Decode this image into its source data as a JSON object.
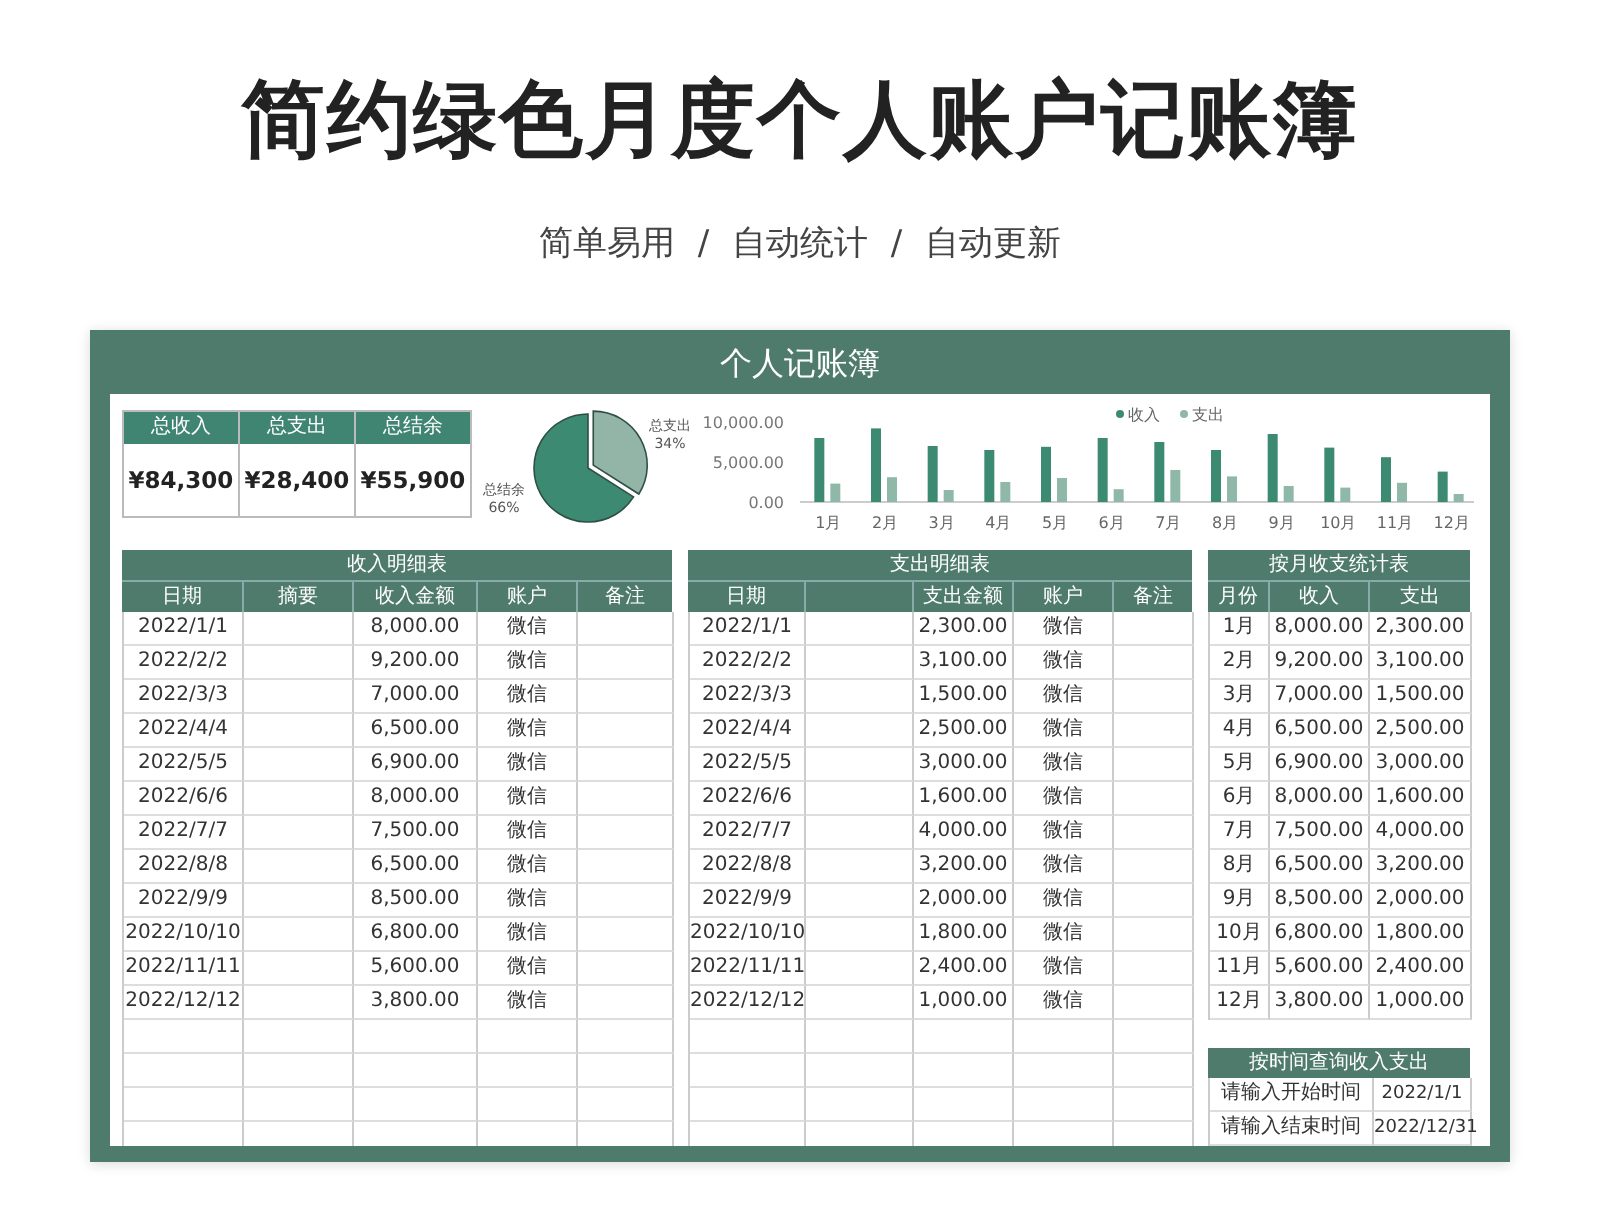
{
  "title": "简约绿色月度个人账户记账簿",
  "subtitle": "简单易用 / 自动统计 / 自动更新",
  "sheet": {
    "title": "个人记账簿",
    "summary": [
      {
        "label": "总收入",
        "value": "¥84,300"
      },
      {
        "label": "总支出",
        "value": "¥28,400"
      },
      {
        "label": "总结余",
        "value": "¥55,900"
      }
    ],
    "pie": {
      "chart_data": {
        "type": "pie",
        "categories": [
          "总支出",
          "总结余"
        ],
        "values": [
          34,
          66
        ],
        "value_labels": [
          "34%",
          "66%"
        ]
      }
    },
    "bars": {
      "chart_data": {
        "type": "bar",
        "categories": [
          "1月",
          "2月",
          "3月",
          "4月",
          "5月",
          "6月",
          "7月",
          "8月",
          "9月",
          "10月",
          "11月",
          "12月"
        ],
        "series": [
          {
            "name": "收入",
            "color": "#3d8a72",
            "values": [
              8000,
              9200,
              7000,
              6500,
              6900,
              8000,
              7500,
              6500,
              8500,
              6800,
              5600,
              3800
            ]
          },
          {
            "name": "支出",
            "color": "#8fb8a8",
            "values": [
              2300,
              3100,
              1500,
              2500,
              3000,
              1600,
              4000,
              3200,
              2000,
              1800,
              2400,
              1000
            ]
          }
        ],
        "legend": "top",
        "ylim": [
          0,
          10000
        ],
        "yticks": [
          {
            "value": 0,
            "label": "0.00"
          },
          {
            "value": 5000,
            "label": "5,000.00"
          },
          {
            "value": 10000,
            "label": "10,000.00"
          }
        ]
      }
    },
    "income": {
      "title": "收入明细表",
      "columns": [
        "日期",
        "摘要",
        "收入金额",
        "账户",
        "备注"
      ],
      "rows": [
        {
          "date": "2022/1/1",
          "amount": "8,000.00",
          "account": "微信"
        },
        {
          "date": "2022/2/2",
          "amount": "9,200.00",
          "account": "微信"
        },
        {
          "date": "2022/3/3",
          "amount": "7,000.00",
          "account": "微信"
        },
        {
          "date": "2022/4/4",
          "amount": "6,500.00",
          "account": "微信"
        },
        {
          "date": "2022/5/5",
          "amount": "6,900.00",
          "account": "微信"
        },
        {
          "date": "2022/6/6",
          "amount": "8,000.00",
          "account": "微信"
        },
        {
          "date": "2022/7/7",
          "amount": "7,500.00",
          "account": "微信"
        },
        {
          "date": "2022/8/8",
          "amount": "6,500.00",
          "account": "微信"
        },
        {
          "date": "2022/9/9",
          "amount": "8,500.00",
          "account": "微信"
        },
        {
          "date": "2022/10/10",
          "amount": "6,800.00",
          "account": "微信"
        },
        {
          "date": "2022/11/11",
          "amount": "5,600.00",
          "account": "微信"
        },
        {
          "date": "2022/12/12",
          "amount": "3,800.00",
          "account": "微信"
        }
      ]
    },
    "expense": {
      "title": "支出明细表",
      "columns": [
        "日期",
        "",
        "支出金额",
        "账户",
        "备注"
      ],
      "rows": [
        {
          "date": "2022/1/1",
          "amount": "2,300.00",
          "account": "微信"
        },
        {
          "date": "2022/2/2",
          "amount": "3,100.00",
          "account": "微信"
        },
        {
          "date": "2022/3/3",
          "amount": "1,500.00",
          "account": "微信"
        },
        {
          "date": "2022/4/4",
          "amount": "2,500.00",
          "account": "微信"
        },
        {
          "date": "2022/5/5",
          "amount": "3,000.00",
          "account": "微信"
        },
        {
          "date": "2022/6/6",
          "amount": "1,600.00",
          "account": "微信"
        },
        {
          "date": "2022/7/7",
          "amount": "4,000.00",
          "account": "微信"
        },
        {
          "date": "2022/8/8",
          "amount": "3,200.00",
          "account": "微信"
        },
        {
          "date": "2022/9/9",
          "amount": "2,000.00",
          "account": "微信"
        },
        {
          "date": "2022/10/10",
          "amount": "1,800.00",
          "account": "微信"
        },
        {
          "date": "2022/11/11",
          "amount": "2,400.00",
          "account": "微信"
        },
        {
          "date": "2022/12/12",
          "amount": "1,000.00",
          "account": "微信"
        }
      ]
    },
    "monthly": {
      "title": "按月收支统计表",
      "columns": [
        "月份",
        "收入",
        "支出"
      ],
      "rows": [
        {
          "month": "1月",
          "income": "8,000.00",
          "expense": "2,300.00"
        },
        {
          "month": "2月",
          "income": "9,200.00",
          "expense": "3,100.00"
        },
        {
          "month": "3月",
          "income": "7,000.00",
          "expense": "1,500.00"
        },
        {
          "month": "4月",
          "income": "6,500.00",
          "expense": "2,500.00"
        },
        {
          "month": "5月",
          "income": "6,900.00",
          "expense": "3,000.00"
        },
        {
          "month": "6月",
          "income": "8,000.00",
          "expense": "1,600.00"
        },
        {
          "month": "7月",
          "income": "7,500.00",
          "expense": "4,000.00"
        },
        {
          "month": "8月",
          "income": "6,500.00",
          "expense": "3,200.00"
        },
        {
          "month": "9月",
          "income": "8,500.00",
          "expense": "2,000.00"
        },
        {
          "month": "10月",
          "income": "6,800.00",
          "expense": "1,800.00"
        },
        {
          "month": "11月",
          "income": "5,600.00",
          "expense": "2,400.00"
        },
        {
          "month": "12月",
          "income": "3,800.00",
          "expense": "1,000.00"
        }
      ]
    },
    "query": {
      "title": "按时间查询收入支出",
      "rows": [
        {
          "label": "请输入开始时间",
          "value": "2022/1/1"
        },
        {
          "label": "请输入结束时间",
          "value": "2022/12/31"
        }
      ]
    }
  }
}
